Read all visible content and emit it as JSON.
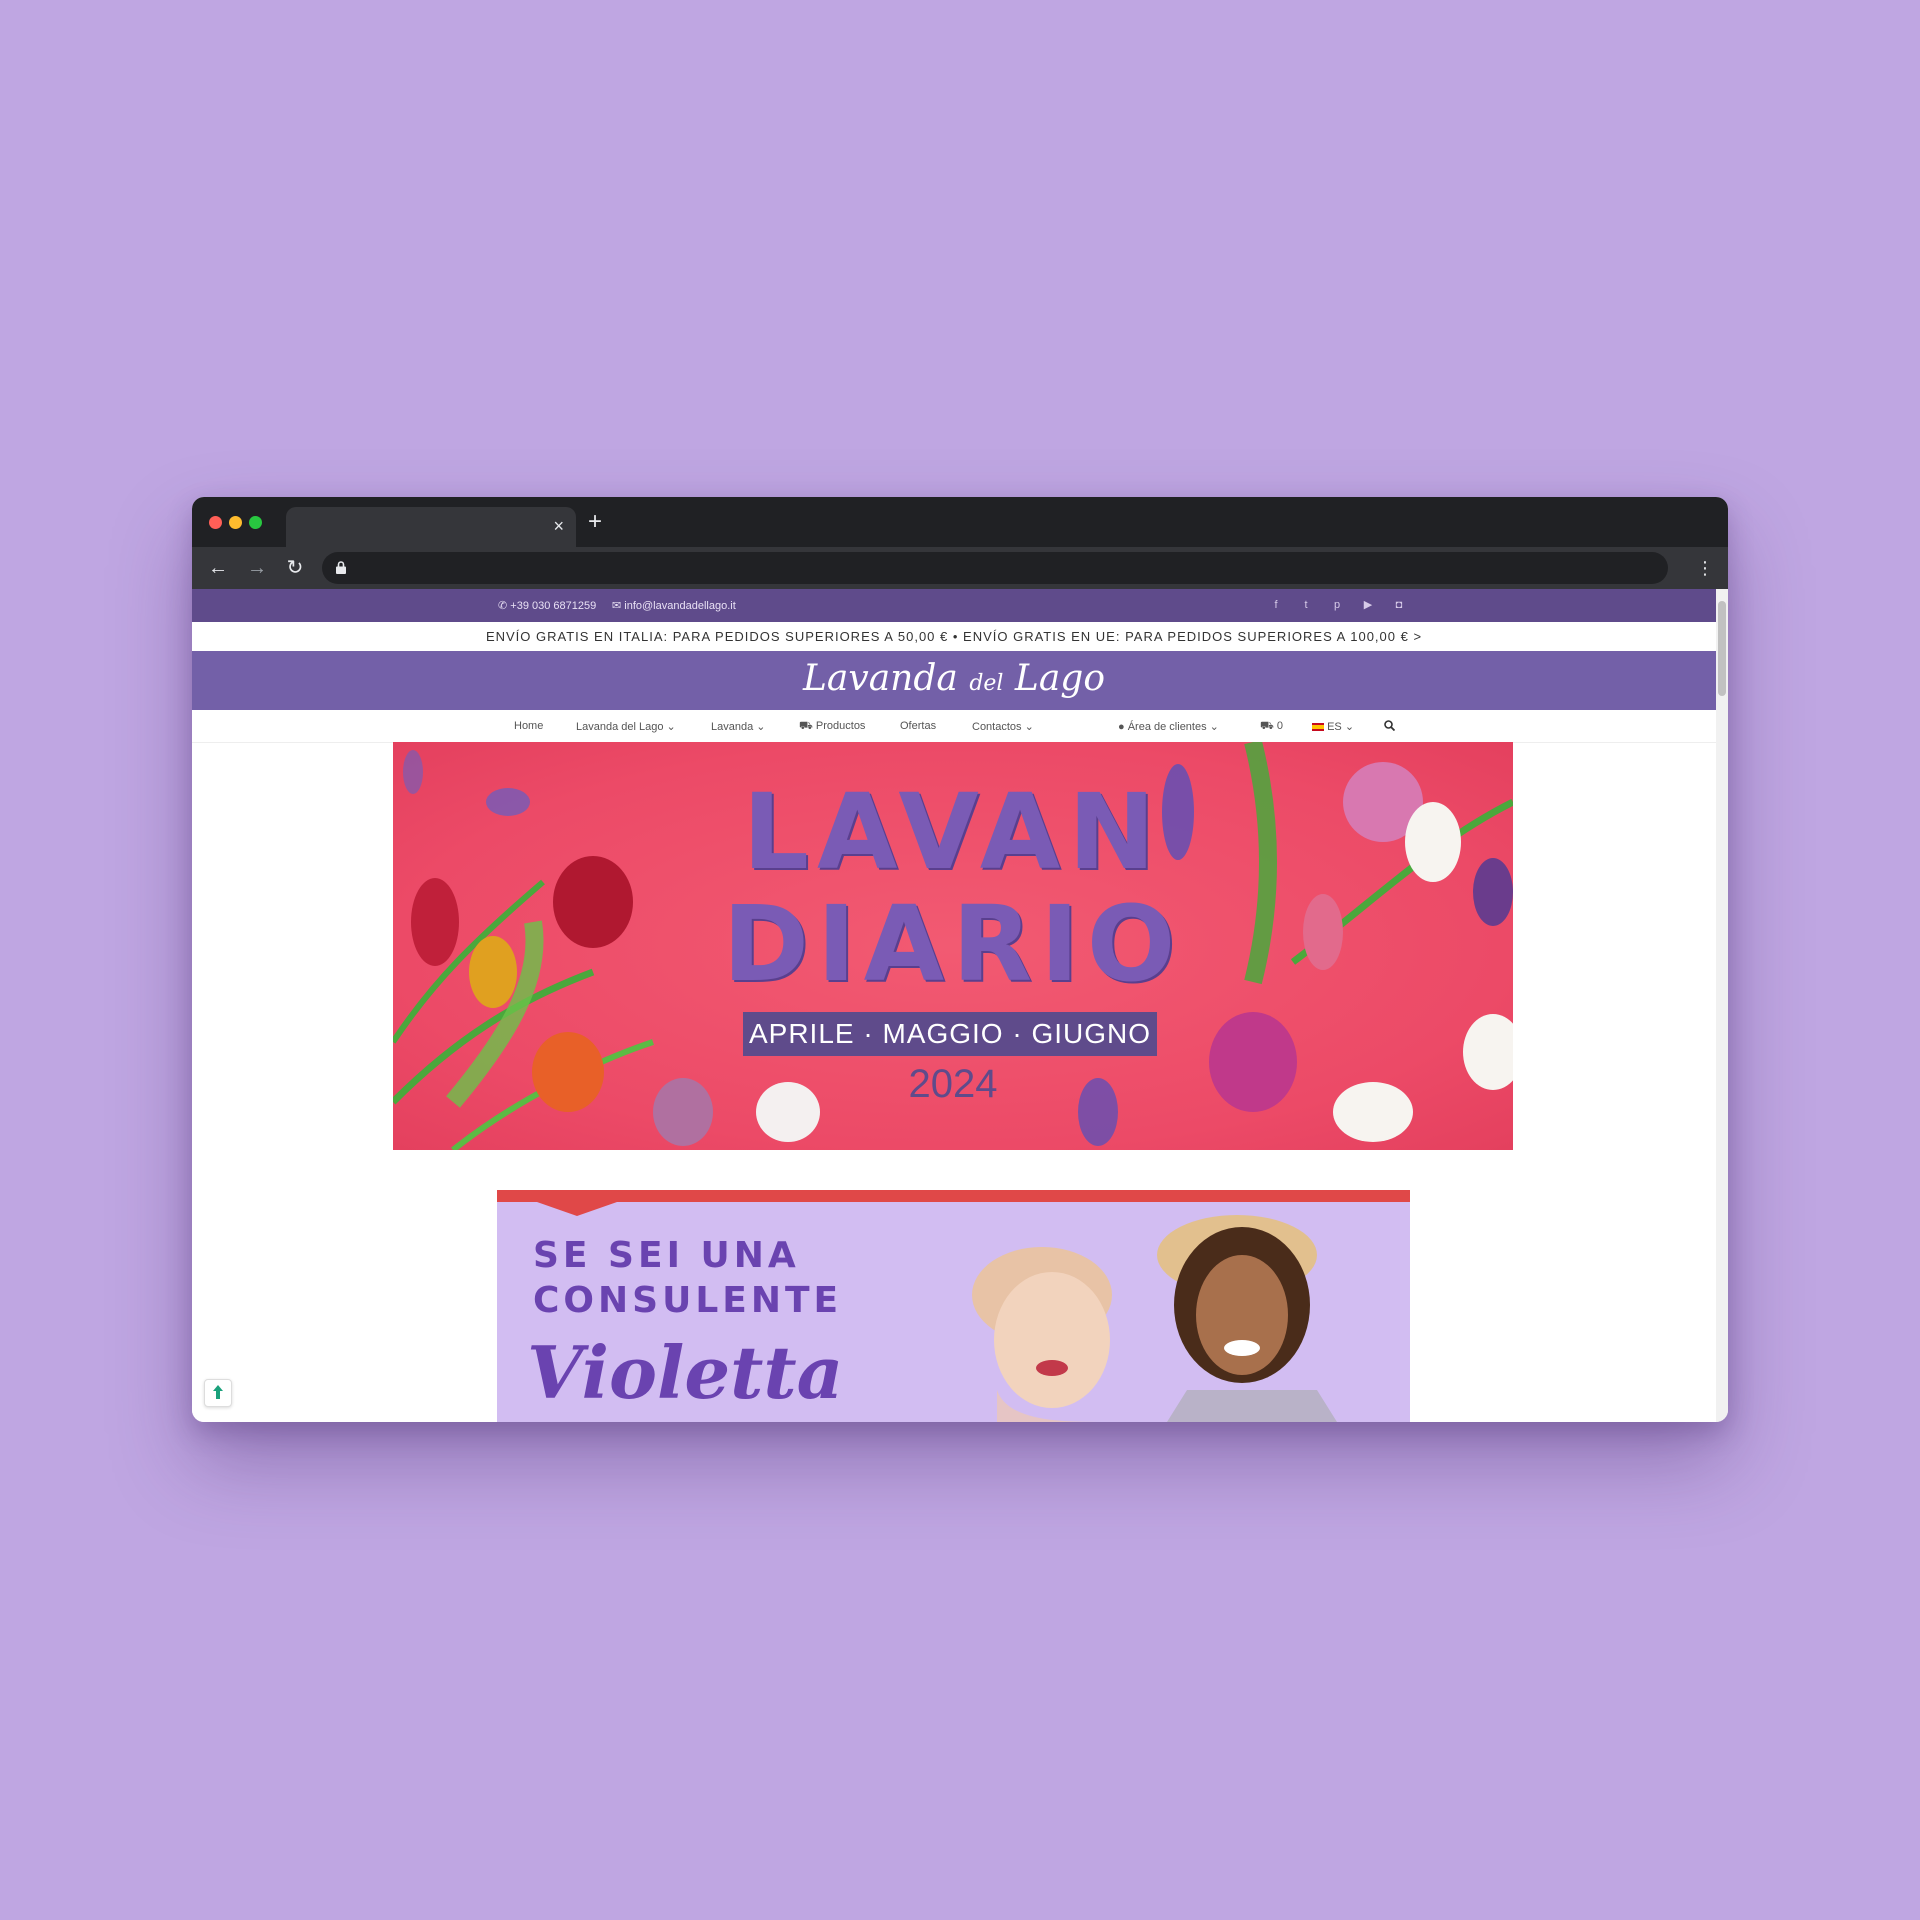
{
  "browser": {
    "tab_close": "×",
    "new_tab": "+",
    "back_icon": "←",
    "forward_icon": "→",
    "reload_icon": "↻",
    "menu_icon": "⋮"
  },
  "topbar": {
    "phone": "+39 030 6871259",
    "email": "info@lavandadellago.it",
    "social_icons": [
      "facebook-icon",
      "twitter-icon",
      "pinterest-icon",
      "youtube-icon",
      "instagram-icon"
    ]
  },
  "shipping_banner": "ENVÍO GRATIS EN ITALIA: PARA PEDIDOS SUPERIORES A 50,00 € • ENVÍO GRATIS EN UE: PARA PEDIDOS SUPERIORES A 100,00 € >",
  "logo": {
    "main": "Lavanda",
    "del": "del",
    "lago": "Lago"
  },
  "nav": {
    "home": "Home",
    "lavanda_del_lago": "Lavanda del Lago",
    "lavanda": "Lavanda",
    "productos": "Productos",
    "ofertas": "Ofertas",
    "contactos": "Contactos",
    "area_clientes": "Área de clientes",
    "cart_count": "0",
    "language": "ES"
  },
  "hero": {
    "line1": "LAVAN",
    "line2": "DIARIO",
    "months": "APRILE · MAGGIO · GIUGNO",
    "year": "2024"
  },
  "promo": {
    "line1": "SE SEI UNA",
    "line2": "CONSULENTE",
    "script": "Violetta"
  },
  "colors": {
    "page_background": "#bfa6e2",
    "topbar": "#5f4b8b",
    "logobar": "#7360a8",
    "hero_pink": "#ec4a67",
    "promo_lilac": "#d2bdf2",
    "promo_red": "#e04848"
  }
}
